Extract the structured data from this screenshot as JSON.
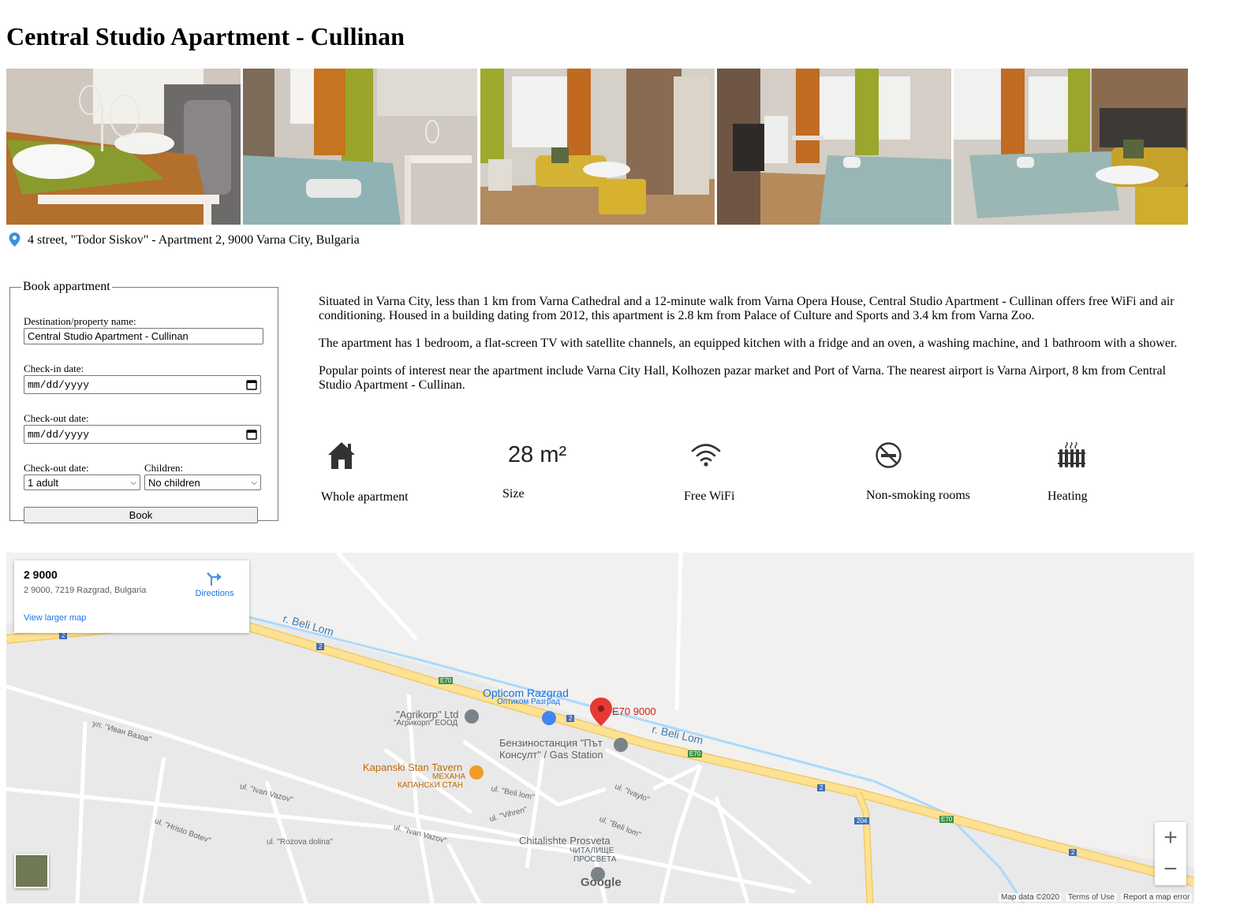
{
  "page": {
    "title": "Central Studio Apartment - Cullinan",
    "address": "4 street, \"Todor Siskov\" - Apartment 2, 9000 Varna City, Bulgaria"
  },
  "gallery": [
    {
      "alt": "table-with-wine-glasses"
    },
    {
      "alt": "bed-and-window"
    },
    {
      "alt": "living-area-yellow-sofa"
    },
    {
      "alt": "kitchen-and-bed"
    },
    {
      "alt": "bed-and-sofa"
    }
  ],
  "booking": {
    "legend": "Book appartment",
    "destination_label": "Destination/property name:",
    "destination_value": "Central Studio Apartment - Cullinan",
    "checkin_label": "Check-in date:",
    "checkin_placeholder": "mm/dd/yyyy",
    "checkout_label": "Check-out date:",
    "checkout_placeholder": "mm/dd/yyyy",
    "adults_label": "Check-out date:",
    "adults_value": "1 adult",
    "children_label": "Children:",
    "children_value": "No children",
    "book_button": "Book"
  },
  "description": [
    "Situated in Varna City, less than 1 km from Varna Cathedral and a 12-minute walk from Varna Opera House, Central Studio Apartment - Cullinan offers free WiFi and air conditioning. Housed in a building dating from 2012, this apartment is 2.8 km from Palace of Culture and Sports and 3.4 km from Varna Zoo.",
    "The apartment has 1 bedroom, a flat-screen TV with satellite channels, an equipped kitchen with a fridge and an oven, a washing machine, and 1 bathroom with a shower.",
    "Popular points of interest near the apartment include Varna City Hall, Kolhozen pazar market and Port of Varna. The nearest airport is Varna Airport, 8 km from Central Studio Apartment - Cullinan."
  ],
  "features": [
    {
      "icon": "house-icon",
      "label": "Whole apartment"
    },
    {
      "icon": "size-text",
      "value": "28 m²",
      "label": "Size"
    },
    {
      "icon": "wifi-icon",
      "label": "Free WiFi"
    },
    {
      "icon": "no-smoking-icon",
      "label": "Non-smoking rooms"
    },
    {
      "icon": "radiator-icon",
      "label": "Heating"
    }
  ],
  "map": {
    "card_title": "2 9000",
    "card_address": "2 9000, 7219 Razgrad, Bulgaria",
    "directions": "Directions",
    "view_larger": "View larger map",
    "pin_label": "E70 9000",
    "labels": {
      "river1": "r. Beli Lom",
      "river2": "r. Beli Lom",
      "opticom": "Opticom Razgrad",
      "opticom_bg": "Оптиком Разград",
      "agrikorp": "\"Agrikorp\" Ltd",
      "agrikorp_bg": "\"Агрикорп\" ЕООД",
      "gas1": "Бензиностанция \"Път",
      "gas2": "Консулт\" / Gas Station",
      "tavern": "Kapanski Stan Tavern",
      "tavern_bg1": "МЕХАНА",
      "tavern_bg2": "КАПАНСКИ СТАН",
      "chitalishte": "Chitalishte Prosveta",
      "chitalishte_bg1": "ЧИТАЛИЩЕ",
      "chitalishte_bg2": "ПРОСВЕТА",
      "ivan_vazov_bg": "ул. \"Иван Вазов\"",
      "ivan_vazov": "ul. \"Ivan Vazov\"",
      "ivan_vazov2": "ul. \"Ivan Vazov\"",
      "hristo_botev": "ul. \"Hristo Botev\"",
      "rozova_dolina": "ul. \"Rozova dolina\"",
      "beli_lom": "ul. \"Beli lom\"",
      "vihren": "ul. \"Vihren\"",
      "ivaylo": "ul. \"Ivaylo\"",
      "beli_lom2": "ul. \"Beli lom\"",
      "e70_a": "E70",
      "e70_b": "E70",
      "e70_c": "E70",
      "r2_a": "2",
      "r2_b": "2",
      "r2_c": "2",
      "r2_d": "2",
      "r2_e": "2",
      "r204": "204",
      "google": "Google"
    },
    "attrib_data": "Map data ©2020",
    "attrib_terms": "Terms of Use",
    "attrib_report": "Report a map error",
    "zoom_in": "+",
    "zoom_out": "−"
  },
  "colors": {
    "pin": "#e53935",
    "road_major": "#fde293",
    "road_major_edge": "#f3c96a",
    "river": "#aadaff",
    "link": "#1a73e8"
  }
}
